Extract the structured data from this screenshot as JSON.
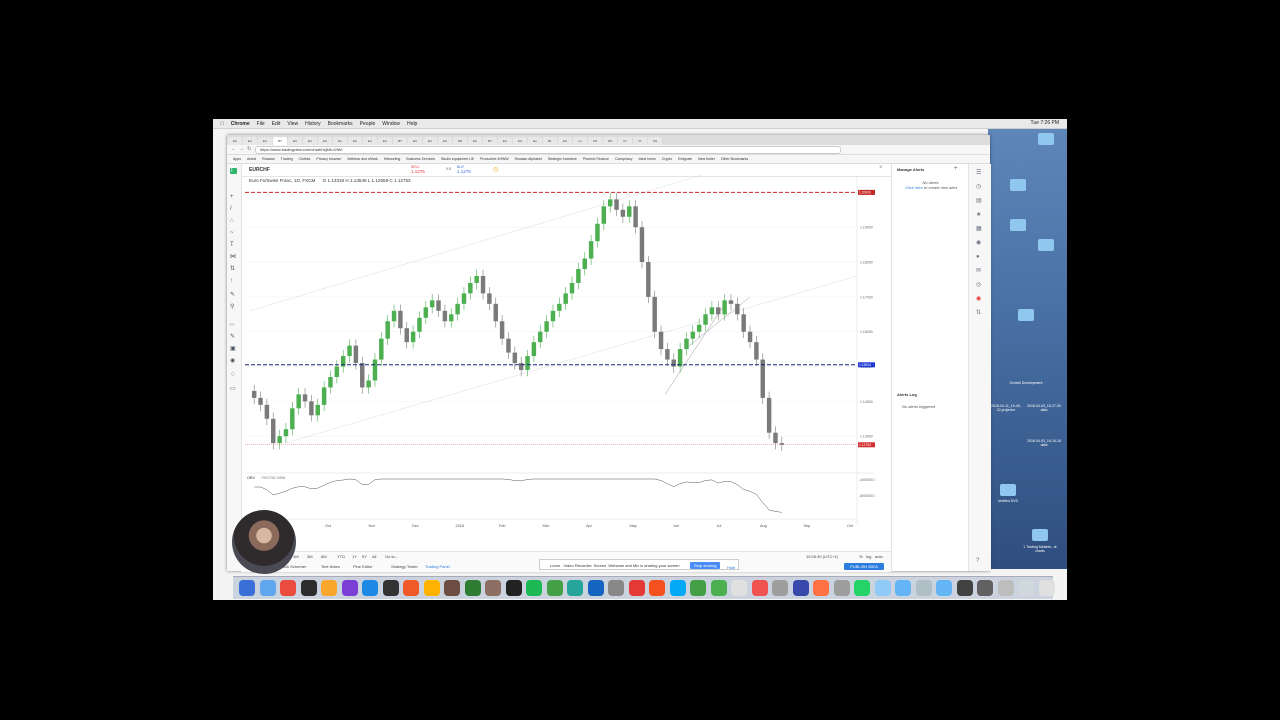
{
  "mac_menubar": {
    "items": [
      "Chrome",
      "File",
      "Edit",
      "View",
      "History",
      "Bookmarks",
      "People",
      "Window",
      "Help"
    ],
    "clock": "Tue 7:26 PM"
  },
  "browser": {
    "tabs": [
      "EU",
      "EU",
      "EU",
      "BT",
      "EU",
      "EU",
      "EU",
      "Ru",
      "EU",
      "EU",
      "EU",
      "BT",
      "EU",
      "EU",
      "EU",
      "ND",
      "EU",
      "BT",
      "EU",
      "EU",
      "Eu",
      "BL",
      "EU",
      "Lo",
      "CN",
      "Wh",
      "IO",
      "Pr",
      "SN"
    ],
    "url": "https://www.tradingview.com/chart/hsjMh-t2iW/",
    "bookmarks": [
      "Apps",
      "Antral",
      "Russian",
      "Trading",
      "Clothes",
      "Privacy browser",
      "Webinar and eMark",
      "Kitesurfing",
      "Business Services",
      "Studio equipment UK",
      "Productive 4HWW",
      "Russian Alphabet",
      "Strategic Investme",
      "Phoenix Finance",
      "Conspiracy",
      "Ideal home",
      "Crypto",
      "Emigrate",
      "New folder",
      "Other Bookmarks"
    ]
  },
  "tradingview": {
    "symbol": "EURCHF",
    "legend": "Euro Fx/Swiss Franc, 1D, FXCM",
    "ohlc": "O 1.13318  H 1.13549  L 1.12659  C 1.12753",
    "sell_label": "SELL",
    "sell_price": "1.1275",
    "buy_label": "BUY",
    "buy_price": "1.1275",
    "spread": "0.5",
    "indicator_label": "OBV",
    "indicator_value": "7902782.9998",
    "ranges": [
      "5D",
      "1M",
      "3M",
      "6M",
      "YTD",
      "1Y",
      "5Y",
      "All",
      "Go to..."
    ],
    "bottom_tabs": [
      "Stock Screener",
      "Text Notes",
      "Pine Editor",
      "Strategy Tester",
      "Trading Panel"
    ],
    "time_readout": "19:26:30 (UTC+1)",
    "scale_opts": [
      "%",
      "log",
      "auto"
    ],
    "publish": "PUBLISH IDEA",
    "right_panel": {
      "title": "Manage Alerts",
      "empty_1": "No alerts.",
      "empty_link": "Click here",
      "empty_2": "to create new alert",
      "log_title": "Alerts Log",
      "log_empty": "No alerts triggered"
    }
  },
  "loom": {
    "message": "Loom - Video Recorder: Screen, Webcam and Mic is sharing your screen.",
    "stop": "Stop sharing",
    "hide": "Hide"
  },
  "desktop_labels": [
    "Growth Development",
    "2018-04-11_19-45-22.projector",
    "2018-04-03_15-17-00 data",
    "2018-04-03_16-16-16 data",
    "Untitled DVD",
    "1 Trading Melanie...le charts"
  ],
  "chart_data": {
    "type": "candlestick",
    "x_tick_labels": [
      "Oct",
      "Nov",
      "Dec",
      "2018",
      "Feb",
      "Mar",
      "Apr",
      "May",
      "Jun",
      "Jul",
      "Aug",
      "Sep",
      "Oct"
    ],
    "y_tick_labels": [
      "1.20000",
      "1.19000",
      "1.18000",
      "1.17000",
      "1.16000",
      "1.15000",
      "1.14000",
      "1.13000"
    ],
    "ylim": [
      1.12,
      1.205
    ],
    "resistance_level": 1.2,
    "support_level": 1.1505,
    "last_price": 1.12753,
    "resistance_tag": "1.20000",
    "support_tag": "1.15004",
    "last_tag": "1.12753",
    "closes": [
      1.141,
      1.139,
      1.135,
      1.128,
      1.13,
      1.132,
      1.138,
      1.142,
      1.14,
      1.136,
      1.139,
      1.144,
      1.147,
      1.15,
      1.153,
      1.156,
      1.151,
      1.144,
      1.146,
      1.152,
      1.158,
      1.163,
      1.166,
      1.161,
      1.157,
      1.16,
      1.164,
      1.167,
      1.169,
      1.166,
      1.163,
      1.165,
      1.168,
      1.171,
      1.174,
      1.176,
      1.171,
      1.168,
      1.163,
      1.158,
      1.154,
      1.151,
      1.149,
      1.153,
      1.157,
      1.16,
      1.163,
      1.166,
      1.168,
      1.171,
      1.174,
      1.178,
      1.181,
      1.186,
      1.191,
      1.196,
      1.198,
      1.195,
      1.193,
      1.196,
      1.19,
      1.18,
      1.17,
      1.16,
      1.155,
      1.152,
      1.15,
      1.155,
      1.158,
      1.16,
      1.162,
      1.165,
      1.167,
      1.165,
      1.169,
      1.168,
      1.165,
      1.16,
      1.157,
      1.152,
      1.141,
      1.131,
      1.128,
      1.12753
    ],
    "obv_ticks": [
      "-4000000.0000",
      "-8000000.0000"
    ]
  }
}
